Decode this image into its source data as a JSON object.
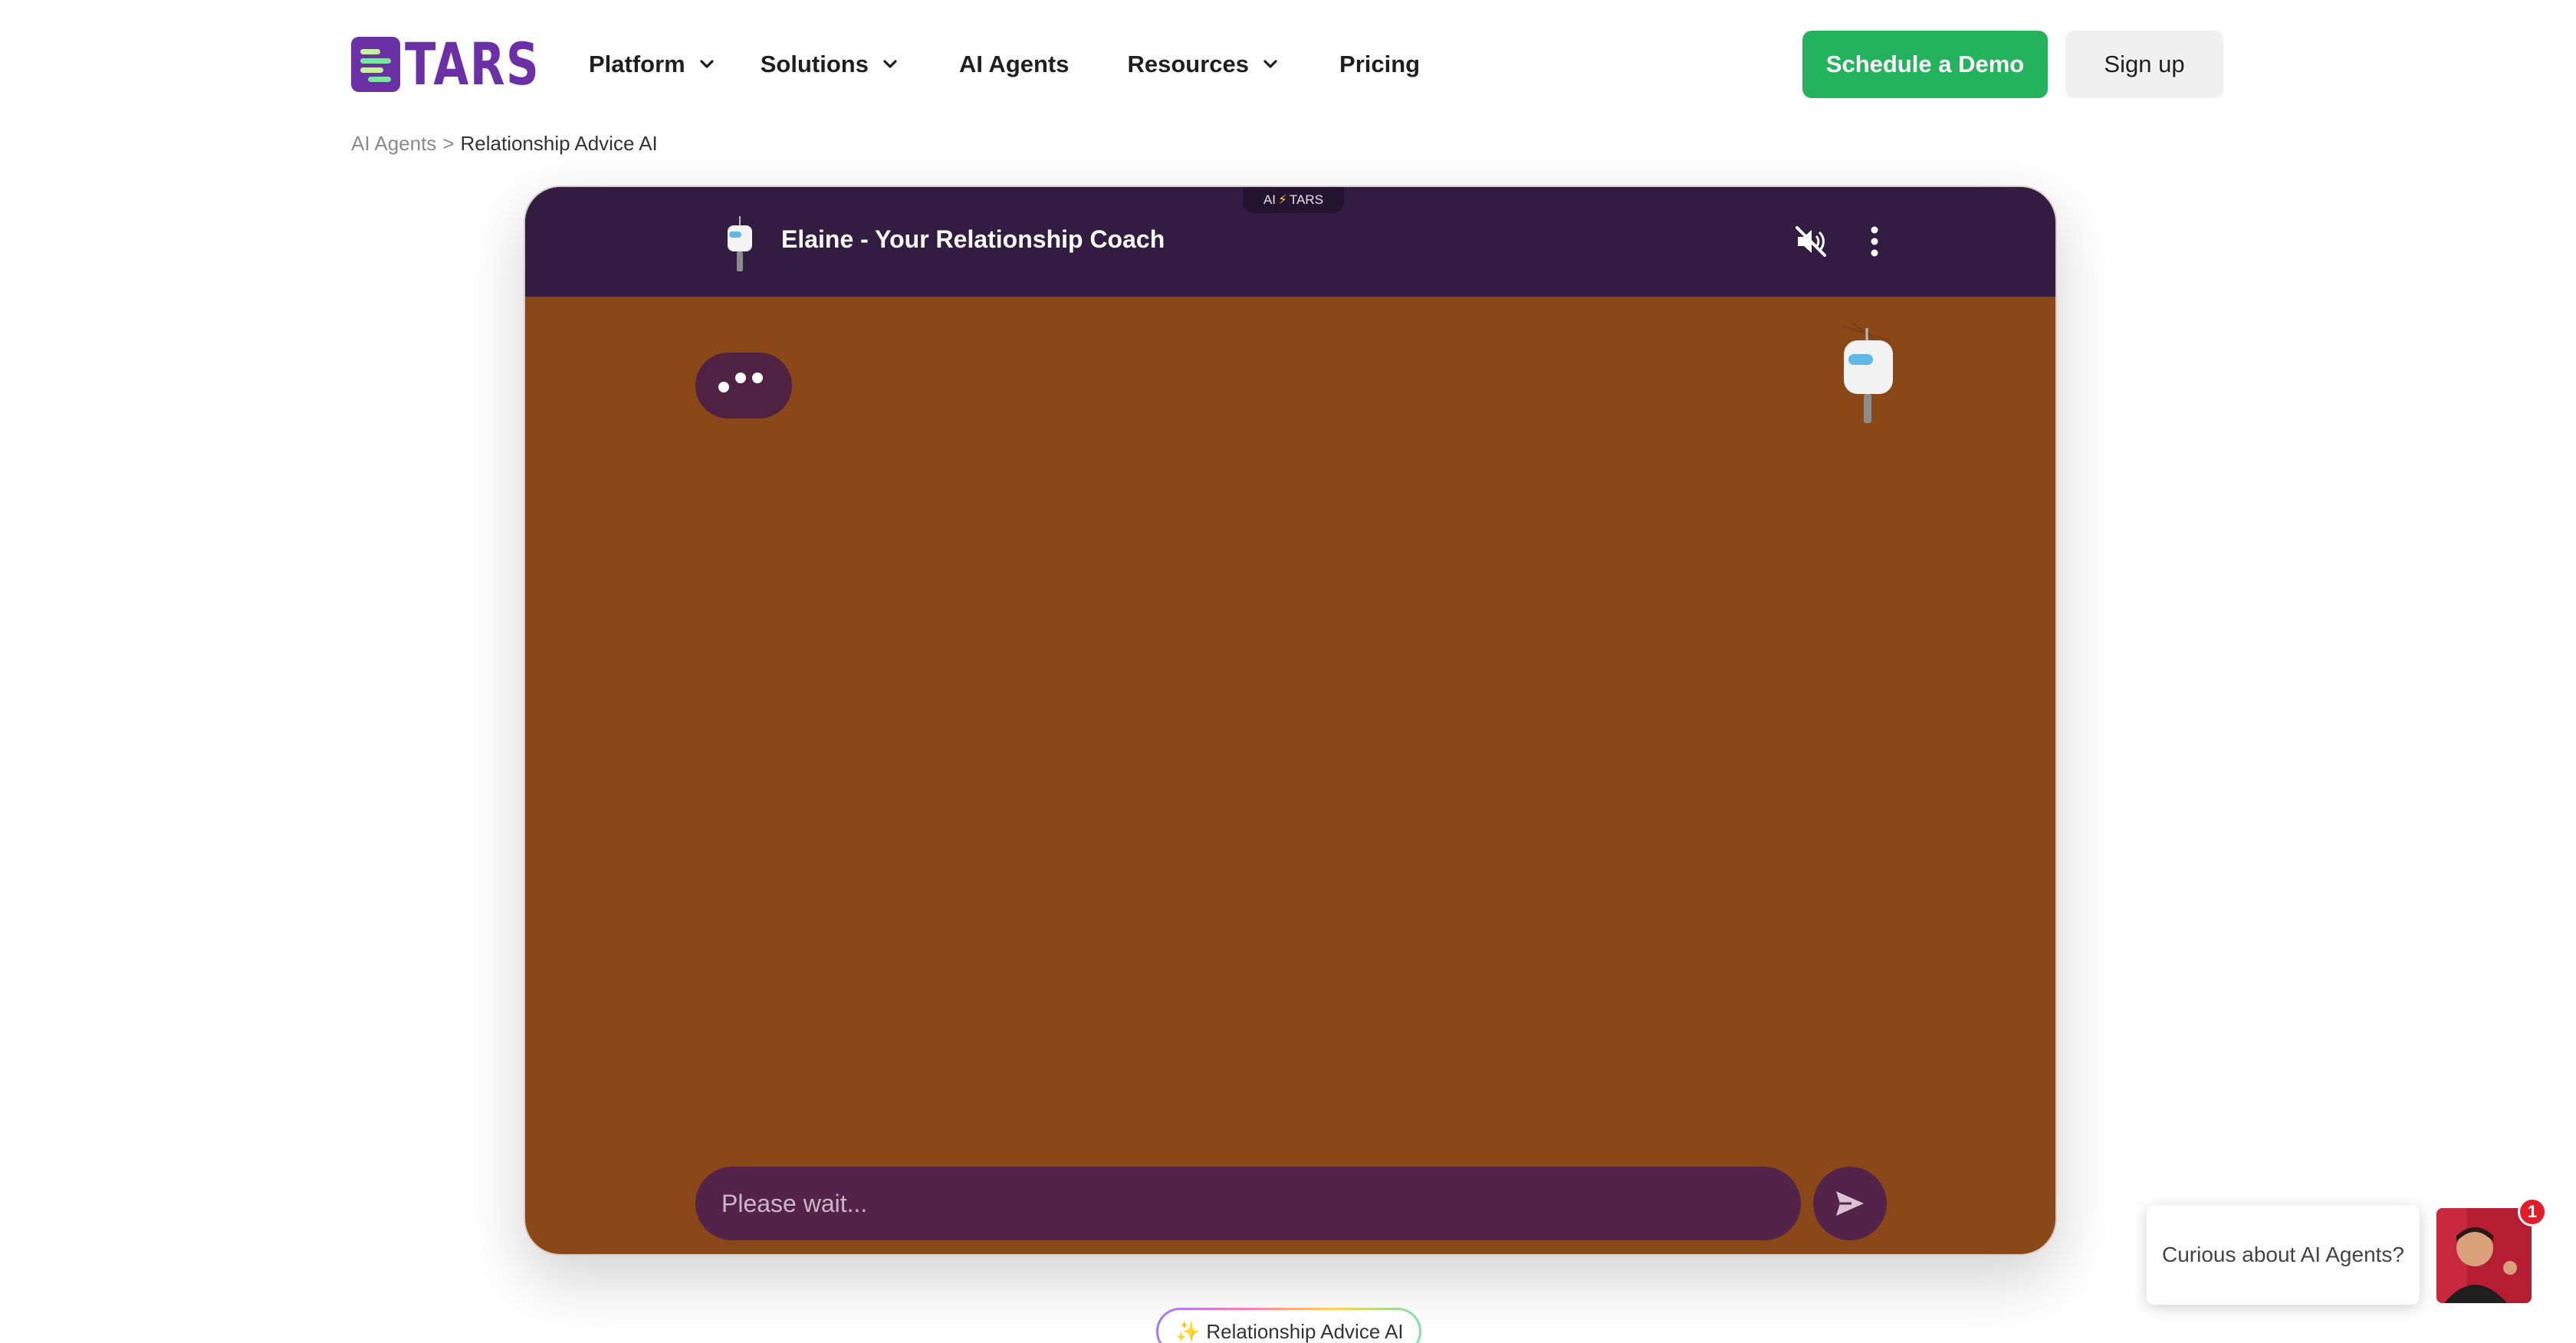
{
  "header": {
    "logo_text": "TARS",
    "nav": [
      {
        "label": "Platform",
        "has_dropdown": true
      },
      {
        "label": "Solutions",
        "has_dropdown": true
      },
      {
        "label": "AI Agents",
        "has_dropdown": false
      },
      {
        "label": "Resources",
        "has_dropdown": true
      },
      {
        "label": "Pricing",
        "has_dropdown": false
      }
    ],
    "demo_button": "Schedule a Demo",
    "signup_button": "Sign up"
  },
  "breadcrumb": {
    "parent": "AI Agents",
    "separator": ">",
    "current": "Relationship Advice AI"
  },
  "chat": {
    "powered_prefix": "AI",
    "powered_suffix": "TARS",
    "title": "Elaine - Your Relationship Coach",
    "input_placeholder": "Please wait...",
    "header_color": "#321c41",
    "body_color": "#8a4819",
    "bubble_color": "#53234a"
  },
  "tag": {
    "label": "Relationship Advice AI"
  },
  "promo": {
    "text": "Curious about AI Agents?",
    "badge_count": "1"
  },
  "colors": {
    "brand": "#6b2fa6",
    "accent_green": "#22b35c"
  }
}
